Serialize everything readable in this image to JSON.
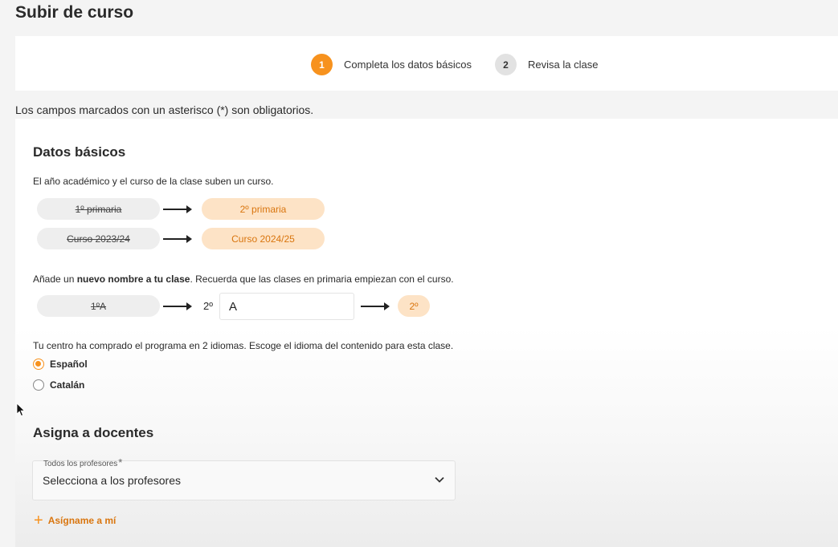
{
  "page": {
    "title": "Subir de curso"
  },
  "stepper": {
    "steps": [
      {
        "number": "1",
        "label": "Completa los datos básicos",
        "state": "active"
      },
      {
        "number": "2",
        "label": "Revisa la clase",
        "state": "inactive"
      }
    ]
  },
  "required_note": "Los campos marcados con un asterisco (*) son obligatorios.",
  "basic_data": {
    "title": "Datos básicos",
    "description": "El año académico y el curso de la clase suben un curso.",
    "rows": [
      {
        "old": "1º primaria",
        "new": "2º primaria"
      },
      {
        "old": "Curso 2023/24",
        "new": "Curso 2024/25"
      }
    ],
    "name_hint_pre": "Añade un ",
    "name_hint_bold": "nuevo nombre a tu clase",
    "name_hint_post": ". Recuerda que las clases en primaria empiezan con el curso.",
    "name_row": {
      "old": "1ºA",
      "prefix": "2º",
      "input_value": "A",
      "result": "2º"
    },
    "language_hint": "Tu centro ha comprado el programa en 2 idiomas. Escoge el idioma del contenido para esta clase.",
    "languages": [
      {
        "label": "Español",
        "checked": true
      },
      {
        "label": "Catalán",
        "checked": false
      }
    ]
  },
  "teachers": {
    "title": "Asigna a docentes",
    "select_label": "Todos los profesores",
    "required_mark": "*",
    "select_value": "Selecciona a los profesores",
    "assign_me_label": "Asígname a mí"
  },
  "colors": {
    "accent": "#f7921e",
    "accent_light": "#fde3c6",
    "accent_text": "#d9750e"
  },
  "icons": {
    "plus": "plus-icon",
    "chevron": "chevron-down-icon",
    "cursor": "mouse-cursor-icon"
  }
}
